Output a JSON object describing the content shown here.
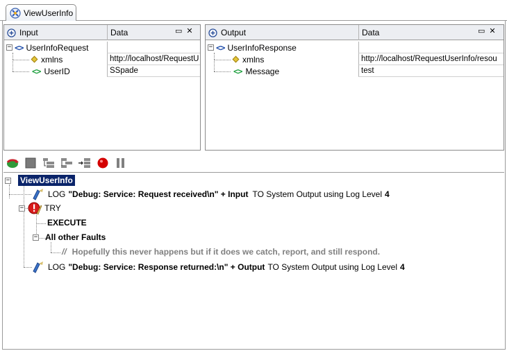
{
  "tab": {
    "label": "ViewUserInfo"
  },
  "input_panel": {
    "title": "Input",
    "data_col": "Data",
    "rows": [
      {
        "name": "UserInfoRequest",
        "value": ""
      },
      {
        "name": "xmlns",
        "value": "http://localhost/RequestU"
      },
      {
        "name": "UserID",
        "value": "SSpade"
      }
    ]
  },
  "output_panel": {
    "title": "Output",
    "data_col": "Data",
    "rows": [
      {
        "name": "UserInfoResponse",
        "value": ""
      },
      {
        "name": "xmlns",
        "value": "http://localhost/RequestUserInfo/resou"
      },
      {
        "name": "Message",
        "value": "test"
      }
    ]
  },
  "panel_controls": {
    "minimize": "▭",
    "close": "✕"
  },
  "toolbar": {
    "buttons": [
      "run-icon",
      "stop-icon",
      "step-into-icon",
      "step-over-icon",
      "step-out-icon",
      "breakpoint-icon",
      "pause-icon"
    ]
  },
  "flow": {
    "root": "ViewUserInfo",
    "log1": {
      "kw": "LOG",
      "expr": "\"Debug: Service: Request received\\n\" + Input",
      "rest": "TO System Output using Log Level",
      "level": "4"
    },
    "try": "TRY",
    "execute": "EXECUTE",
    "faults": "All other Faults",
    "comment": "Hopefully this never happens but if it does we catch, report, and still respond.",
    "log2": {
      "kw": "LOG",
      "expr": "\"Debug: Service: Response returned:\\n\" + Output",
      "rest": "TO System Output using Log Level",
      "level": "4"
    }
  },
  "colors": {
    "selection": "#0a246a",
    "element_blue": "#1b4aa8",
    "element_green": "#20a040",
    "breakpoint": "#d40000"
  }
}
